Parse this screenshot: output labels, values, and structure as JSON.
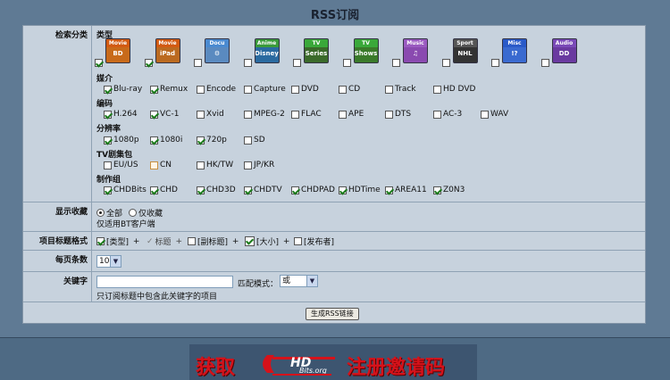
{
  "page_title": "RSS订阅",
  "category_label": "检索分类",
  "type_section": "类型",
  "categories": [
    {
      "tag": "Movie",
      "body": "BD",
      "color": "#c86a1a",
      "tagcolor": "#d25a12",
      "icon": "movie-bluray-icon",
      "checked": true
    },
    {
      "tag": "Movie",
      "body": "iPad",
      "color": "#bb6a20",
      "tagcolor": "#d25a12",
      "icon": "movie-ipad-icon",
      "checked": true
    },
    {
      "tag": "Docu",
      "body": "⚙",
      "color": "#5a8ac0",
      "tagcolor": "#4a8ad0",
      "icon": "documentary-icon",
      "checked": false
    },
    {
      "tag": "Anime",
      "body": "Disney",
      "color": "#2a6aa0",
      "tagcolor": "#3a9a3a",
      "icon": "anime-icon",
      "checked": false
    },
    {
      "tag": "TV",
      "body": "Series",
      "color": "#3a6a2a",
      "tagcolor": "#3aa83a",
      "icon": "tv-series-icon",
      "checked": false
    },
    {
      "tag": "TV",
      "body": "Shows",
      "color": "#3a7a2a",
      "tagcolor": "#3aa83a",
      "icon": "tv-shows-icon",
      "checked": false
    },
    {
      "tag": "Music",
      "body": "♫",
      "color": "#8a4ab0",
      "tagcolor": "#9a5ac0",
      "icon": "music-icon",
      "checked": false
    },
    {
      "tag": "Sport",
      "body": "NHL",
      "color": "#333333",
      "tagcolor": "#555555",
      "icon": "sport-icon",
      "checked": false
    },
    {
      "tag": "Misc",
      "body": "!?",
      "color": "#3a6ad0",
      "tagcolor": "#2a5ac8",
      "icon": "misc-icon",
      "checked": false
    },
    {
      "tag": "Audio",
      "body": "DD",
      "color": "#6a3aa0",
      "tagcolor": "#7a4ab8",
      "icon": "audio-icon",
      "checked": false
    }
  ],
  "medium_section": "媒介",
  "mediums": [
    {
      "label": "Blu-ray",
      "checked": true
    },
    {
      "label": "Remux",
      "checked": true
    },
    {
      "label": "Encode",
      "checked": false
    },
    {
      "label": "Capture",
      "checked": false
    },
    {
      "label": "DVD",
      "checked": false
    },
    {
      "label": "CD",
      "checked": false
    },
    {
      "label": "Track",
      "checked": false
    },
    {
      "label": "HD DVD",
      "checked": false
    }
  ],
  "codec_section": "编码",
  "codecs": [
    {
      "label": "H.264",
      "checked": true
    },
    {
      "label": "VC-1",
      "checked": true
    },
    {
      "label": "Xvid",
      "checked": false
    },
    {
      "label": "MPEG-2",
      "checked": false
    },
    {
      "label": "FLAC",
      "checked": false
    },
    {
      "label": "APE",
      "checked": false
    },
    {
      "label": "DTS",
      "checked": false
    },
    {
      "label": "AC-3",
      "checked": false
    },
    {
      "label": "WAV",
      "checked": false
    }
  ],
  "resolution_section": "分辨率",
  "resolutions": [
    {
      "label": "1080p",
      "checked": true
    },
    {
      "label": "1080i",
      "checked": true
    },
    {
      "label": "720p",
      "checked": true
    },
    {
      "label": "SD",
      "checked": false
    }
  ],
  "tvpack_section": "TV剧集包",
  "tvpacks": [
    {
      "label": "EU/US",
      "checked": false
    },
    {
      "label": "CN",
      "checked": false
    },
    {
      "label": "HK/TW",
      "checked": false
    },
    {
      "label": "JP/KR",
      "checked": false
    }
  ],
  "team_section": "制作组",
  "teams": [
    {
      "label": "CHDBits",
      "checked": true
    },
    {
      "label": "CHD",
      "checked": true
    },
    {
      "label": "CHD3D",
      "checked": true
    },
    {
      "label": "CHDTV",
      "checked": true
    },
    {
      "label": "CHDPAD",
      "checked": true
    },
    {
      "label": "HDTime",
      "checked": true
    },
    {
      "label": "AREA11",
      "checked": true
    },
    {
      "label": "Z0N3",
      "checked": true
    }
  ],
  "display_label": "显示收藏",
  "display_all": "全部",
  "display_fav": "仅收藏",
  "display_note": "仅适用BT客户端",
  "format_label": "项目标题格式",
  "format_items": [
    "[类型]",
    "+",
    "标题",
    "+",
    "[副标题]",
    "+",
    "[大小]",
    "+",
    "[发布者]"
  ],
  "perpage_label": "每页条数",
  "perpage_value": "10",
  "keyword_label": "关键字",
  "keyword_value": "",
  "match_label": "匹配模式：",
  "match_value": "或",
  "keyword_note": "只订阅标题中包含此关键字的项目",
  "generate_button": "生成RSS链接",
  "banner": {
    "left": "获取",
    "logo": "HD",
    "logo_sub": "Bits.org",
    "right": "注册邀请码"
  }
}
